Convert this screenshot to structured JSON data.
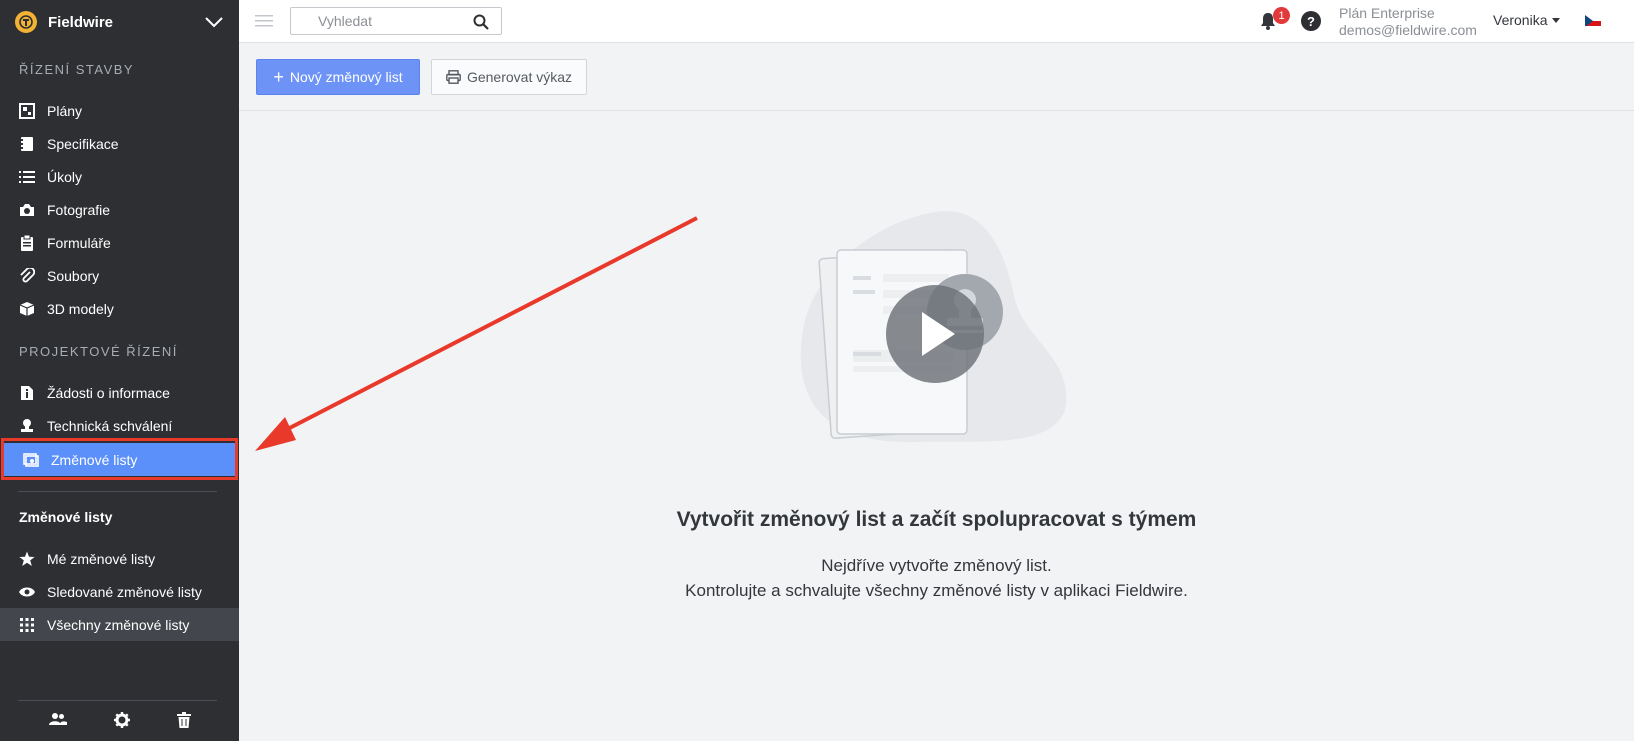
{
  "brand": {
    "name": "Fieldwire"
  },
  "sidebar": {
    "section1": "ŘÍZENÍ STAVBY",
    "section2": "PROJEKTOVÉ ŘÍZENÍ",
    "items1": [
      {
        "label": "Plány",
        "icon": "plans-icon"
      },
      {
        "label": "Specifikace",
        "icon": "specs-icon"
      },
      {
        "label": "Úkoly",
        "icon": "tasks-icon"
      },
      {
        "label": "Fotografie",
        "icon": "camera-icon"
      },
      {
        "label": "Formuláře",
        "icon": "clipboard-icon"
      },
      {
        "label": "Soubory",
        "icon": "paperclip-icon"
      },
      {
        "label": "3D modely",
        "icon": "cube-icon"
      }
    ],
    "items2": [
      {
        "label": "Žádosti o informace",
        "icon": "info-doc-icon"
      },
      {
        "label": "Technická schválení",
        "icon": "stamp-icon"
      },
      {
        "label": "Změnové listy",
        "icon": "change-order-icon"
      }
    ],
    "sub_head": "Změnové listy",
    "sub_items": [
      {
        "label": "Mé změnové listy",
        "icon": "star-icon"
      },
      {
        "label": "Sledované změnové listy",
        "icon": "eye-icon"
      },
      {
        "label": "Všechny změnové listy",
        "icon": "grid-icon"
      }
    ]
  },
  "topbar": {
    "search_placeholder": "Vyhledat",
    "notifications_count": "1",
    "help": "?",
    "plan_name": "Plán Enterprise",
    "plan_email": "demos@fieldwire.com",
    "user_name": "Veronika"
  },
  "toolbar": {
    "new_label": "Nový změnový list",
    "report_label": "Generovat výkaz"
  },
  "empty_state": {
    "title": "Vytvořit změnový list a začít spolupracovat s týmem",
    "line1": "Nejdříve vytvořte změnový list.",
    "line2": "Kontrolujte a schvalujte všechny změnové listy v aplikaci Fieldwire."
  },
  "colors": {
    "accent": "#6d93f7",
    "sidebar": "#2d2f33",
    "highlight": "#e8392b"
  }
}
